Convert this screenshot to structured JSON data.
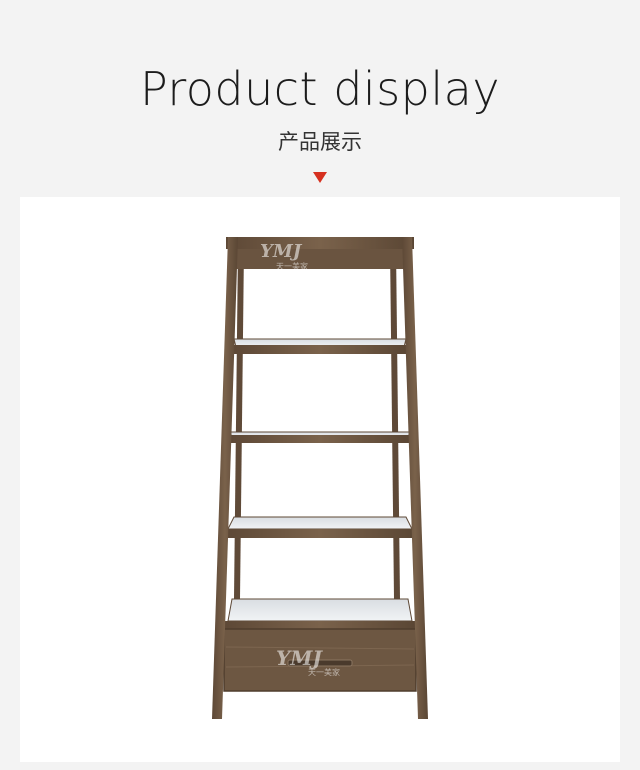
{
  "header": {
    "title": "Product display",
    "subtitle": "产品展示"
  },
  "watermark": {
    "logo_text": "YMJ",
    "sub_text": "天一美家"
  },
  "colors": {
    "background": "#f3f3f3",
    "panel": "#ffffff",
    "accent": "#d6301f",
    "wood": "#6e5843"
  }
}
